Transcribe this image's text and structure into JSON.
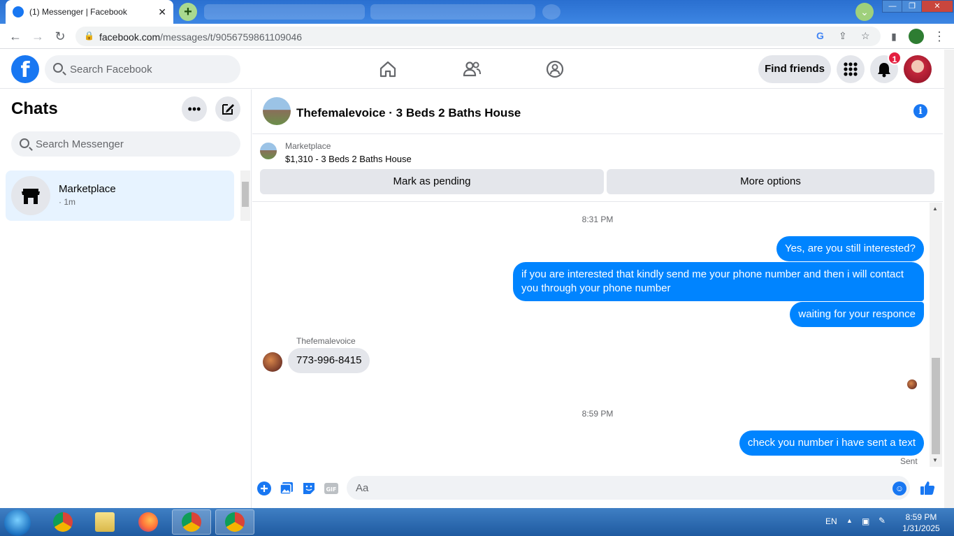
{
  "browser": {
    "active_tab_title": "(1) Messenger | Facebook",
    "url_domain": "facebook.com",
    "url_path": "/messages/t/9056759861109046"
  },
  "fb_header": {
    "search_placeholder": "Search Facebook",
    "find_friends_label": "Find friends",
    "notification_count": "1"
  },
  "sidebar": {
    "title": "Chats",
    "search_placeholder": "Search Messenger",
    "chats": [
      {
        "name": "Marketplace",
        "time": "· 1m"
      }
    ]
  },
  "conversation": {
    "title": "Thefemalevoice · 3 Beds 2 Baths House",
    "marketplace": {
      "label": "Marketplace",
      "listing": "$1,310 - 3 Beds 2 Baths House",
      "mark_pending_label": "Mark as pending",
      "more_options_label": "More options"
    },
    "messages": {
      "stamp1": "8:31 PM",
      "out1": "Yes, are you still interested?",
      "out2": "if you are interested that kindly send me your phone number and then i will contact you through your phone number",
      "out3": "waiting for your responce",
      "sender": "Thefemalevoice",
      "in1": "773-996-8415",
      "stamp2": "8:59 PM",
      "out4": "check you number i have sent a text",
      "status": "Sent"
    },
    "composer_placeholder": "Aa"
  },
  "taskbar": {
    "language": "EN",
    "time": "8:59 PM",
    "date": "1/31/2025"
  },
  "colors": {
    "fb_blue": "#1877f2",
    "bubble_blue": "#0084ff",
    "selected_chat_bg": "#e7f3ff",
    "notification_red": "#e41e3f"
  }
}
